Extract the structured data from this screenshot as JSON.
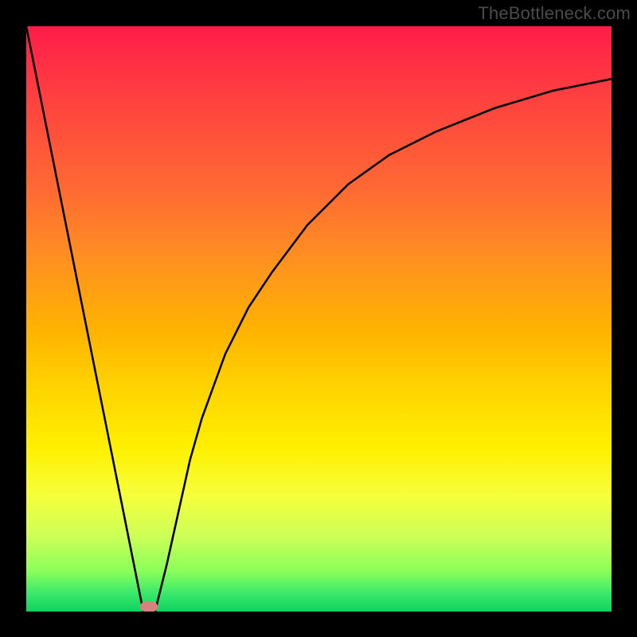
{
  "watermark": "TheBottleneck.com",
  "chart_data": {
    "type": "line",
    "title": "",
    "xlabel": "",
    "ylabel": "",
    "xlim": [
      0,
      100
    ],
    "ylim": [
      0,
      100
    ],
    "grid": false,
    "series": [
      {
        "name": "left-linear-segment",
        "x": [
          0,
          20
        ],
        "y": [
          100,
          0
        ]
      },
      {
        "name": "right-curve",
        "x": [
          22,
          24,
          26,
          28,
          30,
          34,
          38,
          42,
          48,
          55,
          62,
          70,
          80,
          90,
          100
        ],
        "y": [
          0,
          8,
          17,
          26,
          33,
          44,
          52,
          58,
          66,
          73,
          78,
          82,
          86,
          89,
          91
        ]
      }
    ],
    "marker": {
      "name": "bottleneck-point",
      "x_center": 21,
      "y": 0,
      "width_pct": 3.0,
      "color": "#d98080"
    },
    "background_gradient": {
      "top": "#ff1c49",
      "mid_upper": "#ff9120",
      "mid": "#fff000",
      "mid_lower": "#ceff58",
      "bottom": "#10d060"
    }
  }
}
